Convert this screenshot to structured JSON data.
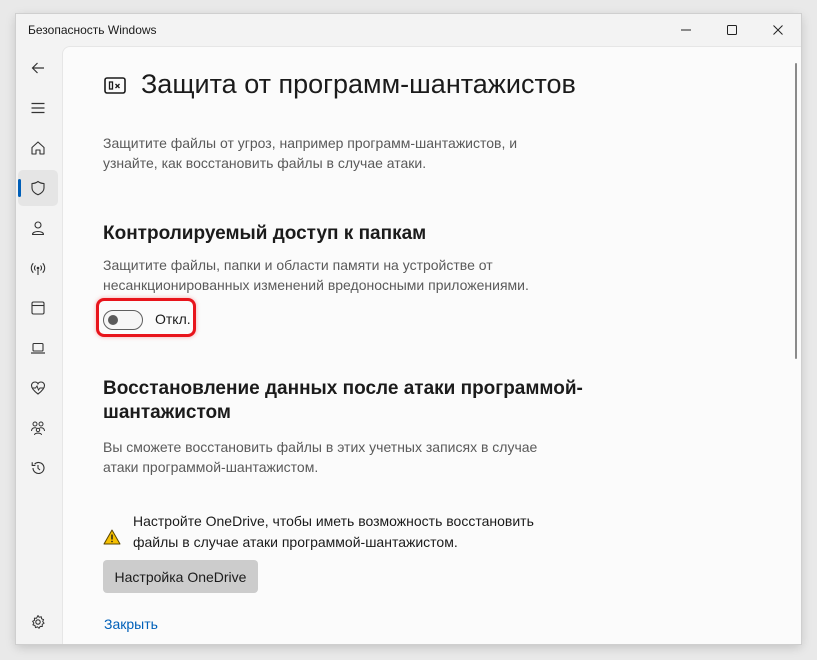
{
  "window": {
    "title": "Безопасность Windows"
  },
  "sidebar": {
    "items": [
      {
        "icon": "back-arrow-icon"
      },
      {
        "icon": "hamburger-menu-icon"
      },
      {
        "icon": "home-icon"
      },
      {
        "icon": "shield-icon",
        "active": true
      },
      {
        "icon": "person-icon"
      },
      {
        "icon": "wireless-antenna-icon"
      },
      {
        "icon": "app-browser-window-icon"
      },
      {
        "icon": "laptop-icon"
      },
      {
        "icon": "heart-pulse-icon"
      },
      {
        "icon": "family-icon"
      },
      {
        "icon": "history-icon"
      },
      {
        "icon": "gear-icon"
      }
    ]
  },
  "page": {
    "title": "Защита от программ-шантажистов",
    "intro_lines": [
      "Защитите файлы от угроз, например программ-шантажистов, и",
      "узнайте, как восстановить файлы в случае атаки."
    ]
  },
  "cfa": {
    "heading": "Контролируемый доступ к папкам",
    "desc_lines": [
      "Защитите файлы, папки и области памяти на устройстве от",
      "несанкционированных изменений вредоносными приложениями."
    ],
    "toggle_state": "off",
    "toggle_label": "Откл."
  },
  "recovery": {
    "heading_lines": [
      "Восстановление данных после атаки программой-",
      "шантажистом"
    ],
    "desc_lines": [
      "Вы сможете восстановить файлы в этих учетных записях в случае",
      "атаки программой-шантажистом."
    ],
    "warning_lines": [
      "Настройте OneDrive, чтобы иметь возможность восстановить",
      "файлы в случае атаки программой-шантажистом."
    ],
    "button_label": "Настройка OneDrive",
    "link_label": "Закрыть"
  },
  "colors": {
    "accent": "#005fb8",
    "link": "#0060b9",
    "highlight": "#e8141b",
    "warning": "#f6c000"
  }
}
